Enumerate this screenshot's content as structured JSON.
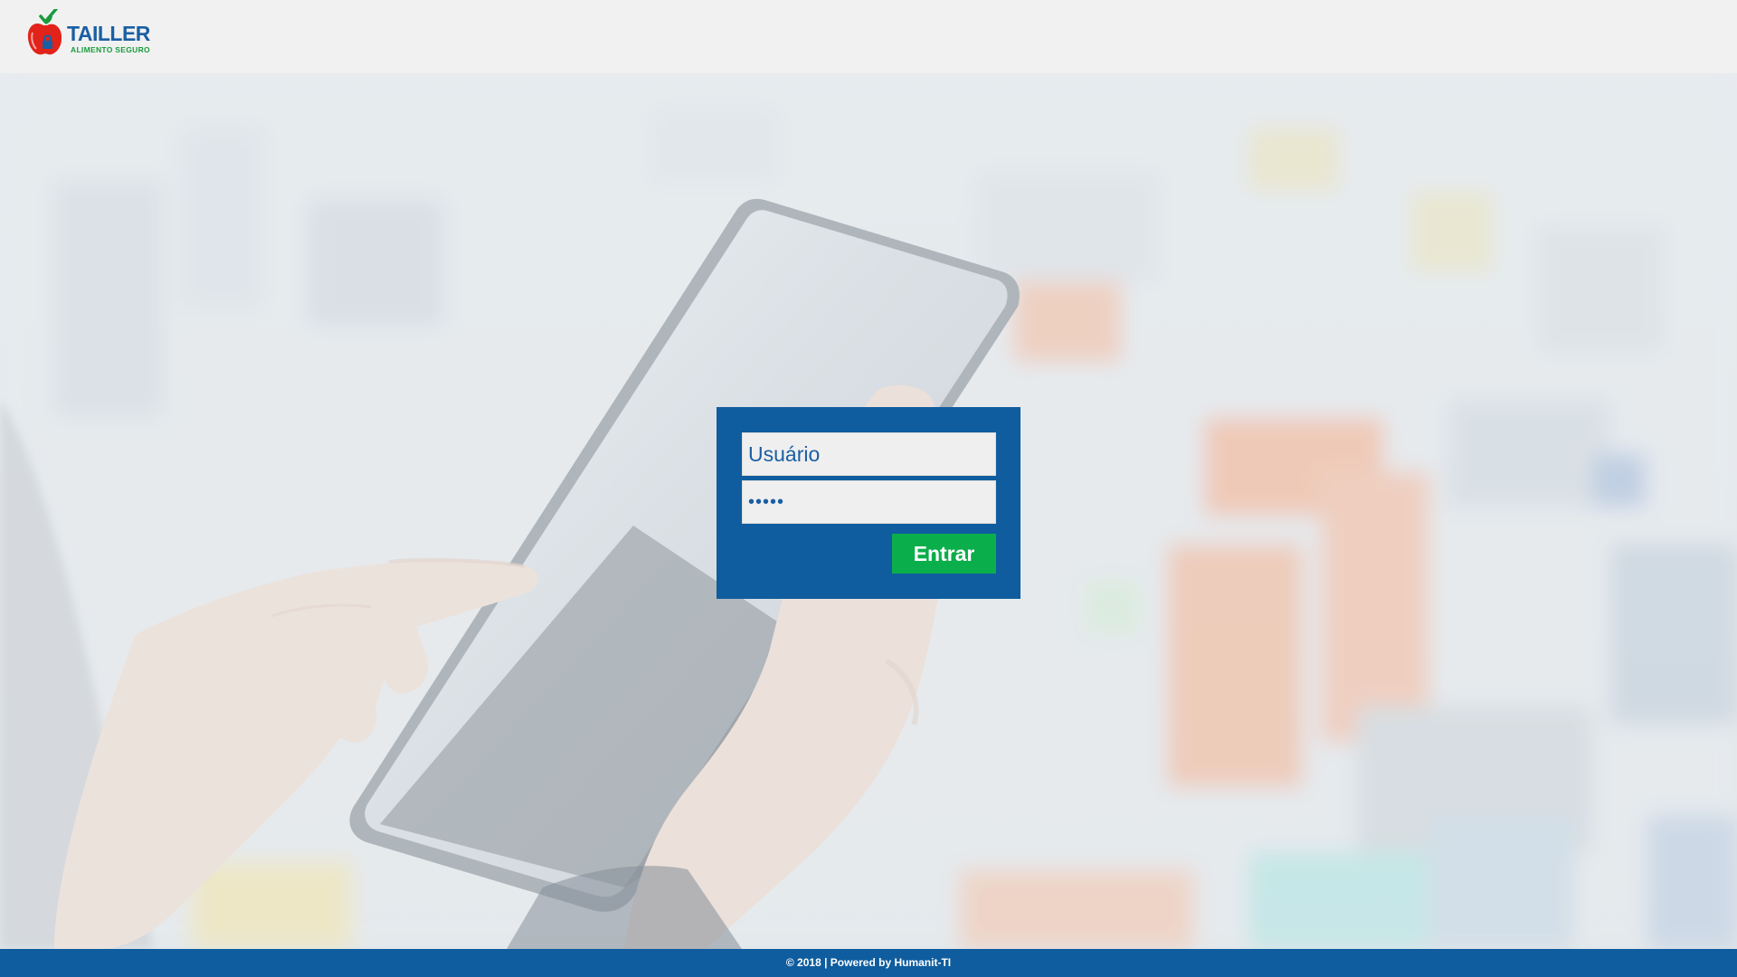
{
  "brand": {
    "name": "TAILLER",
    "tagline": "ALIMENTO SEGURO",
    "colors": {
      "blue": "#1a5fa3",
      "green": "#1a9b3d",
      "red": "#e2231a"
    }
  },
  "login": {
    "username_placeholder": "Usuário",
    "username_value": "",
    "password_value": "•••••",
    "submit_label": "Entrar",
    "card_color": "#0f5d9e",
    "button_color": "#0aae4a"
  },
  "footer": {
    "text": "© 2018 | Powered by Humanit-TI"
  },
  "icons": {
    "logo": "apple-with-padlock-and-checkmark-icon"
  }
}
